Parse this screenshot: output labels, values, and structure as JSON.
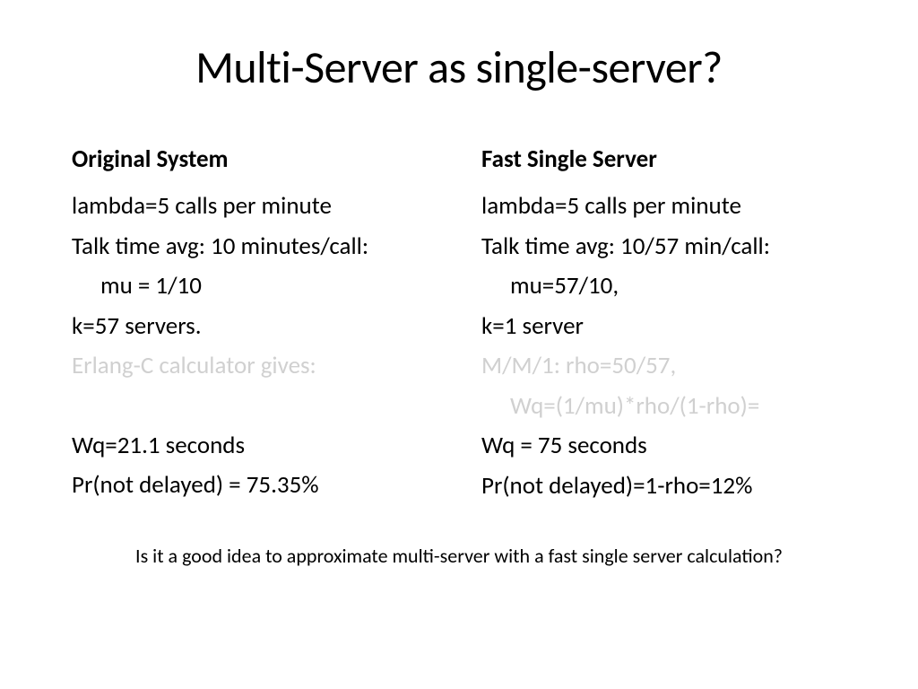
{
  "title": "Multi-Server as single-server?",
  "left": {
    "heading": "Original System",
    "lines": [
      {
        "text": "lambda=5 calls per minute",
        "indent": false,
        "faded": false
      },
      {
        "text": "Talk time avg: 10 minutes/call:",
        "indent": false,
        "faded": false
      },
      {
        "text": "mu = 1/10",
        "indent": true,
        "faded": false
      },
      {
        "text": "k=57 servers.",
        "indent": false,
        "faded": false
      },
      {
        "text": " Erlang-C calculator gives:",
        "indent": false,
        "faded": true
      },
      {
        "text": "",
        "indent": false,
        "faded": false,
        "empty": true
      },
      {
        "text": "Wq=21.1 seconds",
        "indent": false,
        "faded": false
      },
      {
        "text": " Pr(not delayed) = 75.35%",
        "indent": false,
        "faded": false
      }
    ]
  },
  "right": {
    "heading": "Fast Single Server",
    "lines": [
      {
        "text": "lambda=5 calls per minute",
        "indent": false,
        "faded": false
      },
      {
        "text": "Talk time avg: 10/57 min/call:",
        "indent": false,
        "faded": false
      },
      {
        "text": "mu=57/10,",
        "indent": true,
        "faded": false
      },
      {
        "text": " k=1 server",
        "indent": false,
        "faded": false
      },
      {
        "text": "M/M/1: rho=50/57,",
        "indent": false,
        "faded": true
      },
      {
        "text": "Wq=(1/mu)*rho/(1-rho)=",
        "indent": true,
        "faded": true
      },
      {
        "text": "Wq = 75 seconds",
        "indent": false,
        "faded": false
      },
      {
        "text": "Pr(not delayed)=1-rho=12%",
        "indent": false,
        "faded": false
      }
    ]
  },
  "footer": "Is it a good idea to approximate multi-server with a fast single server calculation?"
}
